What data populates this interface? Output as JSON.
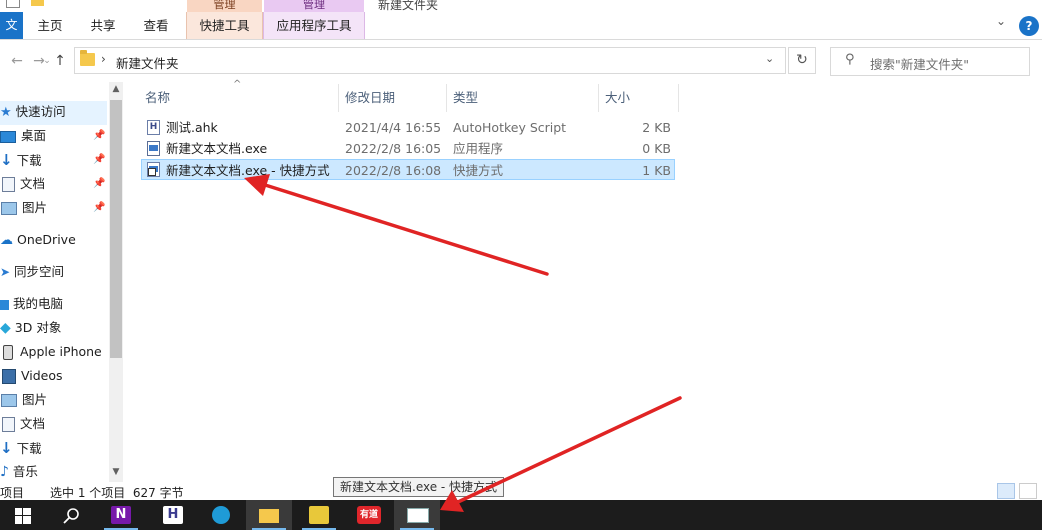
{
  "ribbon": {
    "manage_label_1": "管理",
    "manage_label_2": "管理",
    "window_title": "新建文件夹",
    "tabs": {
      "file": "文件",
      "home": "主页",
      "share": "共享",
      "view": "查看",
      "shortcut_tools": "快捷工具",
      "app_tools": "应用程序工具"
    },
    "help_glyph": "?"
  },
  "address": {
    "path_segment": "新建文件夹",
    "search_placeholder": "搜索\"新建文件夹\""
  },
  "nav": {
    "items": [
      {
        "label": "快速访问",
        "icon": "star-icon"
      },
      {
        "label": "桌面",
        "icon": "desktop-icon"
      },
      {
        "label": "下载",
        "icon": "download-icon"
      },
      {
        "label": "文档",
        "icon": "documents-icon"
      },
      {
        "label": "图片",
        "icon": "pictures-icon"
      },
      {
        "label": "OneDrive",
        "icon": "cloud-icon"
      },
      {
        "label": "同步空间",
        "icon": "sync-icon"
      },
      {
        "label": "我的电脑",
        "icon": "computer-icon"
      },
      {
        "label": "3D 对象",
        "icon": "cube-icon"
      },
      {
        "label": "Apple iPhone",
        "icon": "phone-icon"
      },
      {
        "label": "Videos",
        "icon": "video-icon"
      },
      {
        "label": "图片",
        "icon": "pictures-icon"
      },
      {
        "label": "文档",
        "icon": "documents-icon"
      },
      {
        "label": "下载",
        "icon": "download-icon"
      },
      {
        "label": "音乐",
        "icon": "music-icon"
      }
    ]
  },
  "files": {
    "columns": {
      "name": "名称",
      "date": "修改日期",
      "type": "类型",
      "size": "大小"
    },
    "rows": [
      {
        "name": "测试.ahk",
        "date": "2021/4/4 16:55",
        "type": "AutoHotkey Script",
        "size": "2 KB",
        "icon": "ahk-file-icon"
      },
      {
        "name": "新建文本文档.exe",
        "date": "2022/2/8 16:05",
        "type": "应用程序",
        "size": "0 KB",
        "icon": "exe-file-icon"
      },
      {
        "name": "新建文本文档.exe - 快捷方式",
        "date": "2022/2/8 16:08",
        "type": "快捷方式",
        "size": "1 KB",
        "icon": "shortcut-file-icon",
        "selected": true
      }
    ]
  },
  "status": {
    "items_fragment": "项目",
    "selection": "选中 1 个项目  627 字节"
  },
  "tooltip": {
    "text": "新建文本文档.exe - 快捷方式"
  },
  "taskbar": {
    "onenote_glyph": "N",
    "ahk_glyph": "H",
    "youdao_label": "有道"
  },
  "colors": {
    "accent": "#1a73c8",
    "selection_bg": "#cce8ff",
    "annotation_arrow": "#e02424",
    "taskbar_bg": "#1c1c1c"
  }
}
